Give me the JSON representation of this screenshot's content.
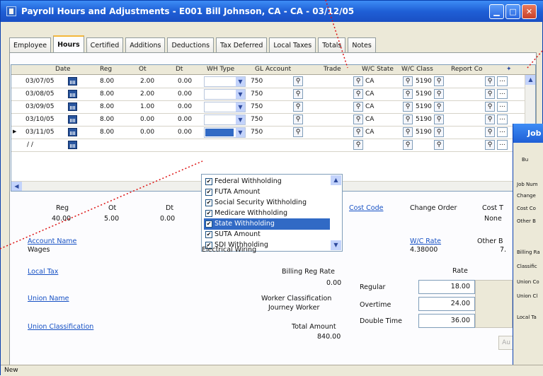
{
  "window": {
    "title": "Payroll Hours and Adjustments - E001 Bill Johnson, CA - CA - 03/12/05"
  },
  "tabs": [
    "Employee",
    "Hours",
    "Certified",
    "Additions",
    "Deductions",
    "Tax Deferred",
    "Local Taxes",
    "Totals",
    "Notes"
  ],
  "grid": {
    "headers": {
      "date": "Date",
      "reg": "Reg",
      "ot": "Ot",
      "dt": "Dt",
      "wh_type": "WH Type",
      "gl_account": "GL Account",
      "trade": "Trade",
      "wc_state": "W/C State",
      "wc_class": "W/C Class",
      "report_co": "Report Co"
    },
    "rows": [
      {
        "date": "03/07/05",
        "reg": "8.00",
        "ot": "2.00",
        "dt": "0.00",
        "gl": "750",
        "state": "CA",
        "wc_class": "5190"
      },
      {
        "date": "03/08/05",
        "reg": "8.00",
        "ot": "2.00",
        "dt": "0.00",
        "gl": "750",
        "state": "CA",
        "wc_class": "5190"
      },
      {
        "date": "03/09/05",
        "reg": "8.00",
        "ot": "1.00",
        "dt": "0.00",
        "gl": "750",
        "state": "CA",
        "wc_class": "5190"
      },
      {
        "date": "03/10/05",
        "reg": "8.00",
        "ot": "0.00",
        "dt": "0.00",
        "gl": "750",
        "state": "CA",
        "wc_class": "5190"
      },
      {
        "date": "03/11/05",
        "reg": "8.00",
        "ot": "0.00",
        "dt": "0.00",
        "gl": "750",
        "state": "CA",
        "wc_class": "5190"
      }
    ],
    "new_row_date": "/ /"
  },
  "wh_dropdown": {
    "items": [
      {
        "label": "Federal Withholding",
        "checked": true,
        "selected": false
      },
      {
        "label": "FUTA Amount",
        "checked": true,
        "selected": false
      },
      {
        "label": "Social Security Withholding",
        "checked": true,
        "selected": false
      },
      {
        "label": "Medicare Withholding",
        "checked": true,
        "selected": false
      },
      {
        "label": "State Withholding",
        "checked": true,
        "selected": true
      },
      {
        "label": "SUTA Amount",
        "checked": true,
        "selected": false
      },
      {
        "label": "SDI Withholding",
        "checked": true,
        "selected": false
      }
    ]
  },
  "totals": {
    "reg_label": "Reg",
    "reg_value": "40.00",
    "ot_label": "Ot",
    "ot_value": "5.00",
    "dt_label": "Dt",
    "dt_value": "0.00",
    "cost_code": "Cost Code",
    "change_order": "Change Order",
    "cost_t_label": "Cost T",
    "cost_t_value": "None"
  },
  "details": {
    "account_name": "Account Name",
    "account_value": "Wages",
    "electrical_wiring": "Electrical Wiring",
    "wc_rate_label": "W/C Rate",
    "wc_rate_value": "4.38000",
    "other_b_label": "Other B",
    "other_b_value": "7.",
    "local_tax": "Local Tax",
    "billing_reg_rate_label": "Billing Reg Rate",
    "billing_reg_rate_value": "0.00",
    "union_name": "Union Name",
    "worker_class_label": "Worker Classification",
    "worker_class_value": "Journey Worker",
    "union_classification": "Union Classification",
    "total_amount_label": "Total Amount",
    "total_amount_value": "840.00",
    "rate_header": "Rate",
    "regular_label": "Regular",
    "regular_rate": "18.00",
    "overtime_label": "Overtime",
    "overtime_rate": "24.00",
    "double_label": "Double Time",
    "double_rate": "36.00",
    "au_button": "Au"
  },
  "side_window": {
    "title": "Job",
    "labels": [
      "Job Num",
      "Change",
      "Cost Co",
      "Other B",
      "Billing Ra",
      "Classific",
      "Union Co",
      "Union Cl",
      "Local Ta"
    ],
    "radio_label": "Bu"
  },
  "status": {
    "text": "New"
  }
}
